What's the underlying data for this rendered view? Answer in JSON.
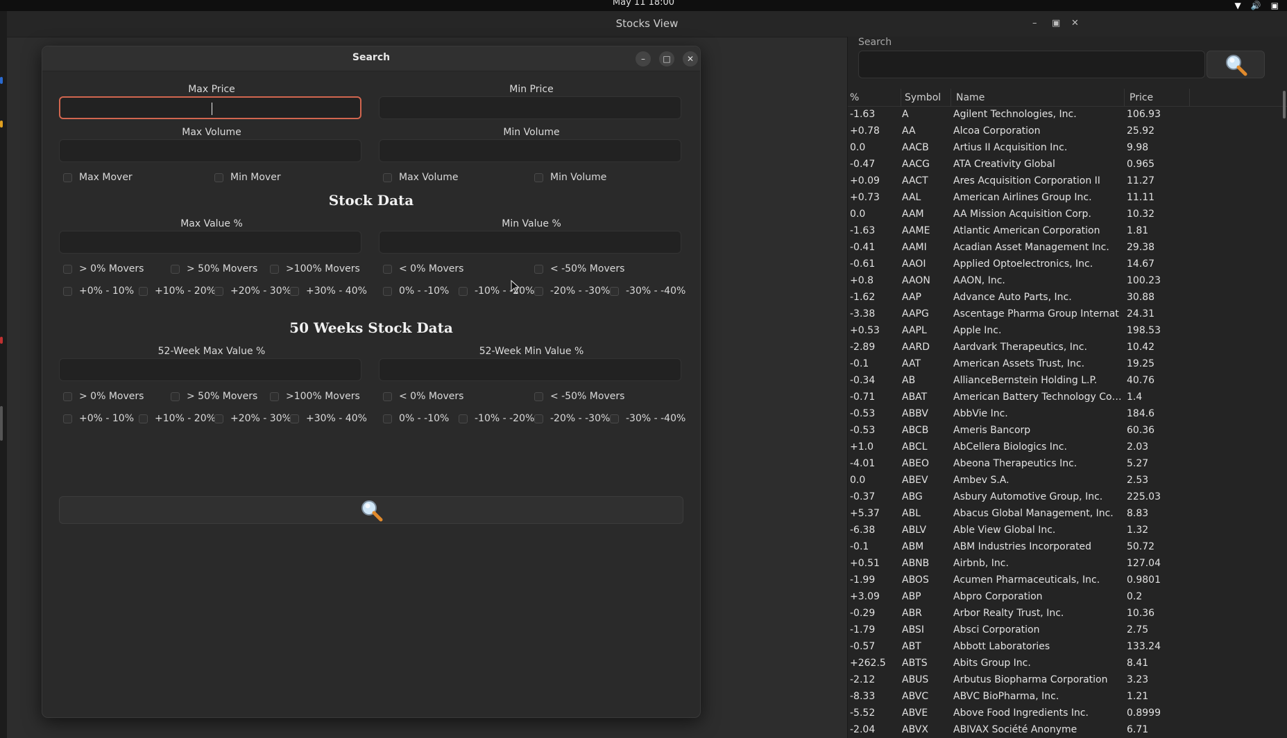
{
  "system": {
    "clock": "May 11 18:00"
  },
  "window": {
    "title": "Stocks View"
  },
  "dialog": {
    "title": "Search",
    "max_price_label": "Max Price",
    "min_price_label": "Min Price",
    "max_volume_label": "Max Volume",
    "min_volume_label": "Min Volume",
    "movers": [
      "Max Mover",
      "Min Mover",
      "Max Volume",
      "Min Volume"
    ],
    "stock_data_title": "Stock Data",
    "max_value_label": "Max Value %",
    "min_value_label": "Min Value %",
    "sd_row1": [
      "> 0% Movers",
      "> 50% Movers",
      ">100% Movers",
      "< 0% Movers",
      "< -50% Movers"
    ],
    "sd_row2": [
      "+0% - 10%",
      "+10% - 20%",
      "+20% - 30%",
      "+30% - 40%",
      "0% - -10%",
      "-10% - -20%",
      "-20% - -30%",
      "-30% - -40%"
    ],
    "week_title": "50 Weeks Stock Data",
    "week_max_label": "52-Week Max Value %",
    "week_min_label": "52-Week Min Value %",
    "wk_row1": [
      "> 0% Movers",
      "> 50% Movers",
      ">100% Movers",
      "< 0% Movers",
      "< -50% Movers"
    ],
    "wk_row2": [
      "+0% - 10%",
      "+10% - 20%",
      "+20% - 30%",
      "+30% - 40%",
      "0% - -10%",
      "-10% - -20%",
      "-20% - -30%",
      "-30% - -40%"
    ]
  },
  "panel": {
    "search_label": "Search",
    "columns": [
      "%",
      "Symbol",
      "Name",
      "Price"
    ],
    "rows": [
      [
        "-1.63",
        "A",
        "Agilent Technologies, Inc.",
        "106.93"
      ],
      [
        "+0.78",
        "AA",
        "Alcoa Corporation",
        "25.92"
      ],
      [
        "0.0",
        "AACB",
        "Artius II Acquisition Inc.",
        "9.98"
      ],
      [
        "-0.47",
        "AACG",
        "ATA Creativity Global",
        "0.965"
      ],
      [
        "+0.09",
        "AACT",
        "Ares Acquisition Corporation II",
        "11.27"
      ],
      [
        "+0.73",
        "AAL",
        "American Airlines Group Inc.",
        "11.11"
      ],
      [
        "0.0",
        "AAM",
        "AA Mission Acquisition Corp.",
        "10.32"
      ],
      [
        "-1.63",
        "AAME",
        "Atlantic American Corporation",
        "1.81"
      ],
      [
        "-0.41",
        "AAMI",
        "Acadian Asset Management Inc.",
        "29.38"
      ],
      [
        "-0.61",
        "AAOI",
        "Applied Optoelectronics, Inc.",
        "14.67"
      ],
      [
        "+0.8",
        "AAON",
        "AAON, Inc.",
        "100.23"
      ],
      [
        "-1.62",
        "AAP",
        "Advance Auto Parts, Inc.",
        "30.88"
      ],
      [
        "-3.38",
        "AAPG",
        "Ascentage Pharma Group Internat",
        "24.31"
      ],
      [
        "+0.53",
        "AAPL",
        "Apple Inc.",
        "198.53"
      ],
      [
        "-2.89",
        "AARD",
        "Aardvark Therapeutics, Inc.",
        "10.42"
      ],
      [
        "-0.1",
        "AAT",
        "American Assets Trust, Inc.",
        "19.25"
      ],
      [
        "-0.34",
        "AB",
        "AllianceBernstein Holding L.P.",
        "40.76"
      ],
      [
        "-0.71",
        "ABAT",
        "American Battery Technology Com...",
        "1.4"
      ],
      [
        "-0.53",
        "ABBV",
        "AbbVie Inc.",
        "184.6"
      ],
      [
        "-0.53",
        "ABCB",
        "Ameris Bancorp",
        "60.36"
      ],
      [
        "+1.0",
        "ABCL",
        "AbCellera Biologics Inc.",
        "2.03"
      ],
      [
        "-4.01",
        "ABEO",
        "Abeona Therapeutics Inc.",
        "5.27"
      ],
      [
        "0.0",
        "ABEV",
        "Ambev S.A.",
        "2.53"
      ],
      [
        "-0.37",
        "ABG",
        "Asbury Automotive Group, Inc.",
        "225.03"
      ],
      [
        "+5.37",
        "ABL",
        "Abacus Global Management, Inc.",
        "8.83"
      ],
      [
        "-6.38",
        "ABLV",
        "Able View Global Inc.",
        "1.32"
      ],
      [
        "-0.1",
        "ABM",
        "ABM Industries Incorporated",
        "50.72"
      ],
      [
        "+0.51",
        "ABNB",
        "Airbnb, Inc.",
        "127.04"
      ],
      [
        "-1.99",
        "ABOS",
        "Acumen Pharmaceuticals, Inc.",
        "0.9801"
      ],
      [
        "+3.09",
        "ABP",
        "Abpro Corporation",
        "0.2"
      ],
      [
        "-0.29",
        "ABR",
        "Arbor Realty Trust, Inc.",
        "10.36"
      ],
      [
        "-1.79",
        "ABSI",
        "Absci Corporation",
        "2.75"
      ],
      [
        "-0.57",
        "ABT",
        "Abbott Laboratories",
        "133.24"
      ],
      [
        "+262.5",
        "ABTS",
        "Abits Group Inc.",
        "8.41"
      ],
      [
        "-2.12",
        "ABUS",
        "Arbutus Biopharma Corporation",
        "3.23"
      ],
      [
        "-8.33",
        "ABVC",
        "ABVC BioPharma, Inc.",
        "1.21"
      ],
      [
        "-5.52",
        "ABVE",
        "Above Food Ingredients Inc.",
        "0.8999"
      ],
      [
        "-2.04",
        "ABVX",
        "ABIVAX Société Anonyme",
        "6.71"
      ]
    ]
  },
  "colors": {
    "focus_border": "#d2664f",
    "background": "#2b2b2b",
    "magnifier_handle": "#e08a2c"
  },
  "icons": {
    "search": "magnifier-icon"
  }
}
